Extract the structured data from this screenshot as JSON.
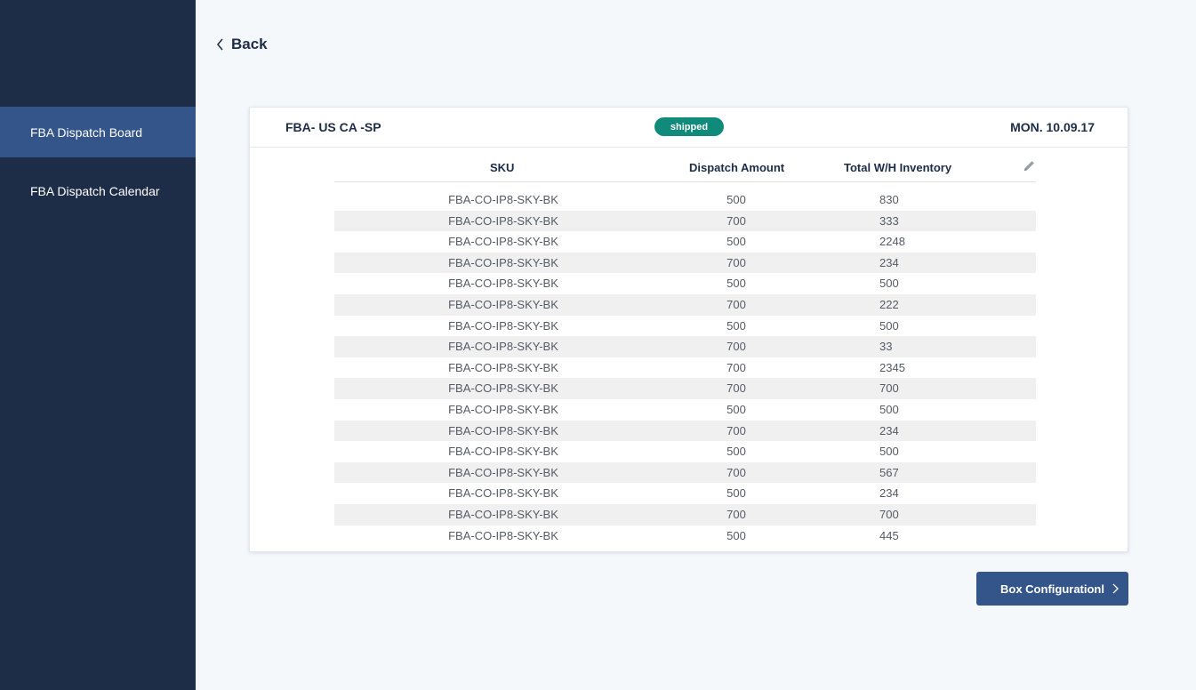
{
  "sidebar": {
    "items": [
      {
        "label": "FBA Dispatch Board",
        "active": true
      },
      {
        "label": "FBA Dispatch Calendar",
        "active": false
      }
    ]
  },
  "back": {
    "label": "Back",
    "icon": "chevron-left-icon"
  },
  "card": {
    "title": "FBA- US CA -SP",
    "status": "shipped",
    "status_color": "#0f8a7b",
    "date": "MON. 10.09.17"
  },
  "table": {
    "headers": {
      "sku": "SKU",
      "dispatch": "Dispatch Amount",
      "inventory": "Total W/H Inventory"
    },
    "edit_icon": "pencil-icon",
    "rows": [
      {
        "sku": "FBA-CO-IP8-SKY-BK",
        "dispatch": "500",
        "inventory": "830"
      },
      {
        "sku": "FBA-CO-IP8-SKY-BK",
        "dispatch": "700",
        "inventory": "333"
      },
      {
        "sku": "FBA-CO-IP8-SKY-BK",
        "dispatch": "500",
        "inventory": "2248"
      },
      {
        "sku": "FBA-CO-IP8-SKY-BK",
        "dispatch": "700",
        "inventory": "234"
      },
      {
        "sku": "FBA-CO-IP8-SKY-BK",
        "dispatch": "500",
        "inventory": "500"
      },
      {
        "sku": "FBA-CO-IP8-SKY-BK",
        "dispatch": "700",
        "inventory": "222"
      },
      {
        "sku": "FBA-CO-IP8-SKY-BK",
        "dispatch": "500",
        "inventory": "500"
      },
      {
        "sku": "FBA-CO-IP8-SKY-BK",
        "dispatch": "700",
        "inventory": "33"
      },
      {
        "sku": "FBA-CO-IP8-SKY-BK",
        "dispatch": "700",
        "inventory": "2345"
      },
      {
        "sku": "FBA-CO-IP8-SKY-BK",
        "dispatch": "700",
        "inventory": "700"
      },
      {
        "sku": "FBA-CO-IP8-SKY-BK",
        "dispatch": "500",
        "inventory": "500"
      },
      {
        "sku": "FBA-CO-IP8-SKY-BK",
        "dispatch": "700",
        "inventory": "234"
      },
      {
        "sku": "FBA-CO-IP8-SKY-BK",
        "dispatch": "500",
        "inventory": "500"
      },
      {
        "sku": "FBA-CO-IP8-SKY-BK",
        "dispatch": "700",
        "inventory": "567"
      },
      {
        "sku": "FBA-CO-IP8-SKY-BK",
        "dispatch": "500",
        "inventory": "234"
      },
      {
        "sku": "FBA-CO-IP8-SKY-BK",
        "dispatch": "700",
        "inventory": "700"
      },
      {
        "sku": "FBA-CO-IP8-SKY-BK",
        "dispatch": "500",
        "inventory": "445"
      }
    ]
  },
  "box_button": {
    "label": "Box Configurationl",
    "icon": "chevron-right-icon"
  },
  "colors": {
    "sidebar_bg": "#1e2d47",
    "sidebar_active": "#34558a",
    "page_bg": "#f5f8fb",
    "button_bg": "#34558a"
  }
}
